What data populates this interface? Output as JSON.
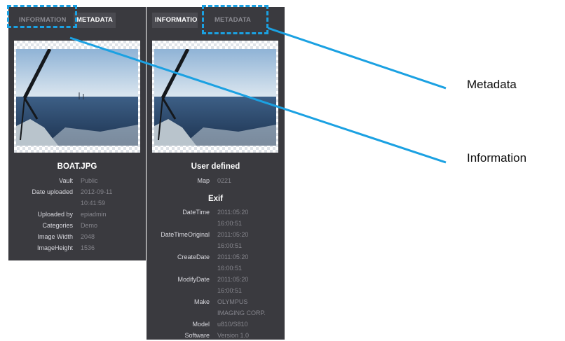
{
  "left_panel": {
    "tabs": {
      "information": "INFORMATION",
      "metadata": "METADATA",
      "active": "metadata"
    },
    "file_title": "BOAT.JPG",
    "fields": [
      {
        "key": "Vault",
        "value": "Public"
      },
      {
        "key": "Date uploaded",
        "value": "2012-09-11"
      },
      {
        "key": "",
        "value": "10:41:59"
      },
      {
        "key": "Uploaded by",
        "value": "epiadmin"
      },
      {
        "key": "Categories",
        "value": "Demo"
      },
      {
        "key": "Image Width",
        "value": "2048"
      },
      {
        "key": "ImageHeight",
        "value": "1536"
      }
    ]
  },
  "right_panel": {
    "tabs": {
      "information": "INFORMATIO",
      "metadata": "METADATA",
      "active": "information"
    },
    "section_user": "User defined",
    "user_fields": [
      {
        "key": "Map",
        "value": "0221"
      }
    ],
    "section_exif": "Exif",
    "exif_fields": [
      {
        "key": "DateTime",
        "value": "2011:05:20"
      },
      {
        "key": "",
        "value": "16:00:51"
      },
      {
        "key": "DateTimeOriginal",
        "value": "2011:05:20"
      },
      {
        "key": "",
        "value": "16:00:51"
      },
      {
        "key": "CreateDate",
        "value": "2011:05:20"
      },
      {
        "key": "",
        "value": "16:00:51"
      },
      {
        "key": "ModifyDate",
        "value": "2011:05:20"
      },
      {
        "key": "",
        "value": "16:00:51"
      },
      {
        "key": "Make",
        "value": "OLYMPUS"
      },
      {
        "key": "",
        "value": "IMAGING CORP."
      },
      {
        "key": "Model",
        "value": "u810/S810"
      },
      {
        "key": "Software",
        "value": "Version 1.0"
      }
    ]
  },
  "callouts": {
    "metadata": "Metadata",
    "information": "Information"
  },
  "colors": {
    "panel": "#3a3a3f",
    "callout_accent": "#1ba1e2",
    "value_text": "#85858c",
    "key_text": "#d8d8de"
  }
}
